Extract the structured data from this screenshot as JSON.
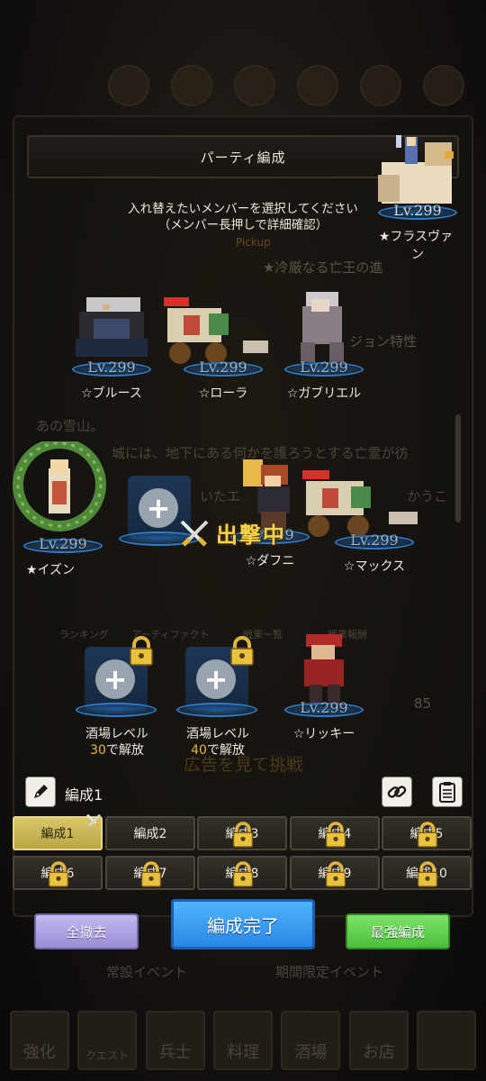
{
  "modal": {
    "title": "パーティ編成",
    "instruction_line1": "入れ替えたいメンバーを選択してください",
    "instruction_line2": "（メンバー長押しで詳細確認）"
  },
  "selected_character": {
    "level": "Lv.299",
    "name": "★フラスヴァ",
    "name_tail": "ン"
  },
  "row1": [
    {
      "level": "Lv.299",
      "name": "☆ブルース"
    },
    {
      "level": "Lv.299",
      "name": "☆ローラ"
    },
    {
      "level": "Lv.299",
      "name": "☆ガブリエル"
    }
  ],
  "row2": [
    {
      "level": "Lv.299",
      "name": "★イズン"
    },
    {
      "level": "Lv.299",
      "name": "☆ダフニ"
    },
    {
      "level": "Lv.299",
      "name": "☆マックス"
    }
  ],
  "sortie_label": "出撃中",
  "locked_slots": [
    {
      "line1": "酒場レベル",
      "number": "30",
      "line2": "で解放"
    },
    {
      "line1": "酒場レベル",
      "number": "40",
      "line2": "で解放"
    }
  ],
  "row3_character": {
    "level": "Lv.299",
    "name": "☆リッキー"
  },
  "party": {
    "name": "編成1"
  },
  "tabs": [
    {
      "label": "編成1"
    },
    {
      "label": "編成2"
    },
    {
      "label": "編成3"
    },
    {
      "label": "編成4"
    },
    {
      "label": "編成5"
    },
    {
      "label": "編成6"
    },
    {
      "label": "編成7"
    },
    {
      "label": "編成8"
    },
    {
      "label": "編成9"
    },
    {
      "label": "編成10"
    }
  ],
  "buttons": {
    "clear_all": "全撤去",
    "done": "編成完了",
    "best": "最強編成"
  },
  "background": {
    "pickup": "Pickup",
    "banner": "★冷厳なる亡王の進",
    "dungeon_traits": "ジョン特性",
    "story1": "あの雪山。",
    "story2": "城には、地下にある何かを護ろうとする亡霊が彷",
    "story3": "いたエ",
    "story4": "かうこ",
    "ranking": "ランキング",
    "artifact": "アーティファクト",
    "records": "戦果一覧",
    "rewards": "戦果報酬",
    "count": "85",
    "ad_challenge": "広告を見て挑戦",
    "normal_event": "常設イベント",
    "limited_event": "期間限定イベント",
    "nav": [
      "強化",
      "クエスト",
      "兵士",
      "料理",
      "酒場",
      "お店",
      ""
    ]
  },
  "colors": {
    "accent_gold": "#f5d24a",
    "done_blue": "#2a86e4",
    "best_green": "#4cbf3a",
    "clear_purple": "#9a8ed4"
  }
}
